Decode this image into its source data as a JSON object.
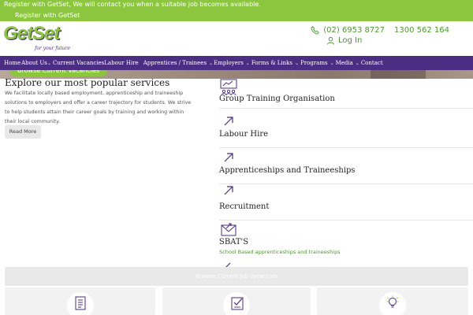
{
  "topbar": {
    "announcement": "Register with GetSet, We will contact you when a suitable job becomes available.",
    "register_link": "Register with GetSet"
  },
  "header": {
    "logo_text": "GetSet",
    "logo_tagline": "for your future",
    "phone_1": "(02) 6953 8727",
    "phone_2": "1300 562 164",
    "login_label": "Log In"
  },
  "nav": {
    "items": [
      {
        "label": "Home",
        "has_dropdown": false
      },
      {
        "label": "About Us",
        "has_dropdown": true
      },
      {
        "label": "Current Vacancies",
        "has_dropdown": false
      },
      {
        "label": "Labour Hire",
        "has_dropdown": false
      },
      {
        "label": "Apprentices / Trainees",
        "has_dropdown": true
      },
      {
        "label": "Employers",
        "has_dropdown": true
      },
      {
        "label": "Forms & Links",
        "has_dropdown": true
      },
      {
        "label": "Programs",
        "has_dropdown": true
      },
      {
        "label": "Media",
        "has_dropdown": true
      },
      {
        "label": "Contact",
        "has_dropdown": false
      }
    ]
  },
  "hero": {
    "button_label": "Browse Current Vacancies"
  },
  "intro": {
    "title": "Explore our most popular services",
    "body": "We facilitate locally based employment, apprenticeship and traineeship solutions to employers and offer a career trajectory for students. We strive to help students attain their career goals by training and working within their local community.",
    "read_more": "Read More"
  },
  "services": [
    {
      "title": "Group Training Organisation",
      "icon": "group-training-icon",
      "subtitle": ""
    },
    {
      "title": "Labour Hire",
      "icon": "arrow-up-right-icon",
      "subtitle": ""
    },
    {
      "title": "Apprenticeships and Traineeships",
      "icon": "arrow-up-right-icon",
      "subtitle": ""
    },
    {
      "title": "Recruitment",
      "icon": "arrow-up-right-icon",
      "subtitle": ""
    },
    {
      "title": "SBAT'S",
      "icon": "envelope-icon",
      "subtitle": "School Based apprenticeships and traineeships"
    }
  ],
  "browse_bar": {
    "label": "Browse Current Job vacancies"
  },
  "cards": [
    {
      "icon": "document-list-icon"
    },
    {
      "icon": "checklist-icon"
    },
    {
      "icon": "lightbulb-icon"
    }
  ],
  "colors": {
    "brand_green": "#8cc63f",
    "brand_purple": "#4b2d83",
    "link_green": "#4b9a2c"
  }
}
